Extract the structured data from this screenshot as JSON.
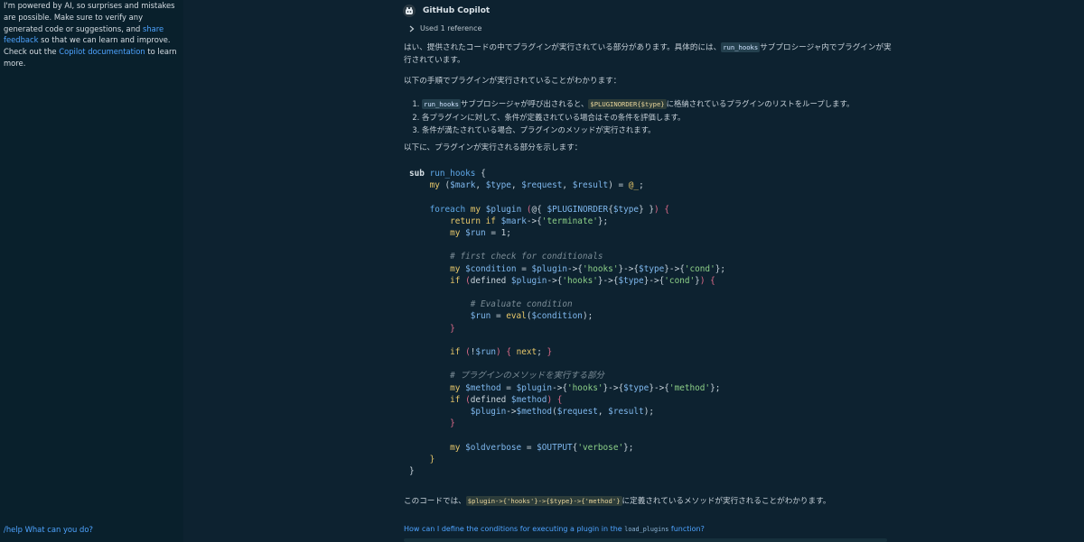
{
  "sidebar": {
    "intro_part1": "I'm powered by AI, so surprises and mistakes are possible. Make sure to verify any generated code or suggestions, and ",
    "share_feedback": "share feedback",
    "intro_part2": " so that we can learn and improve. Check out the ",
    "copilot_docs": "Copilot documentation",
    "intro_part3": " to learn more.",
    "help_text": "/help What can you do?"
  },
  "header": {
    "name": "GitHub Copilot"
  },
  "references": {
    "label": "Used 1 reference"
  },
  "message": {
    "p1_a": "はい、提供されたコードの中でプラグインが実行されている部分があります。具体的には、",
    "p1_code": "run_hooks",
    "p1_b": "サブプロシージャ内でプラグインが実行されています。",
    "p2": "以下の手順でプラグインが実行されていることがわかります：",
    "steps": [
      {
        "code": "run_hooks",
        "text_a": "サブプロシージャが呼び出されると、",
        "code2": "$PLUGINORDER{$type}",
        "text_b": "に格納されているプラグインのリストをループします。"
      },
      {
        "text": "各プラグインに対して、条件が定義されている場合はその条件を評価します。"
      },
      {
        "text": "条件が満たされている場合、プラグインのメソッドが実行されます。"
      }
    ],
    "p3": "以下に、プラグインが実行される部分を示します：",
    "conclusion_a": "このコードでは、",
    "conclusion_code": "$plugin->{'hooks'}->{$type}->{'method'}",
    "conclusion_b": "に定義されているメソッドが実行されることがわかります。"
  },
  "followup": {
    "text_a": "How can I define the conditions for executing a plugin in the ",
    "code": "load_plugins",
    "text_b": " function?"
  },
  "colors": {
    "sidebar_bg": "#09202c",
    "main_bg": "#0d2230",
    "link": "#4ea3ff"
  }
}
